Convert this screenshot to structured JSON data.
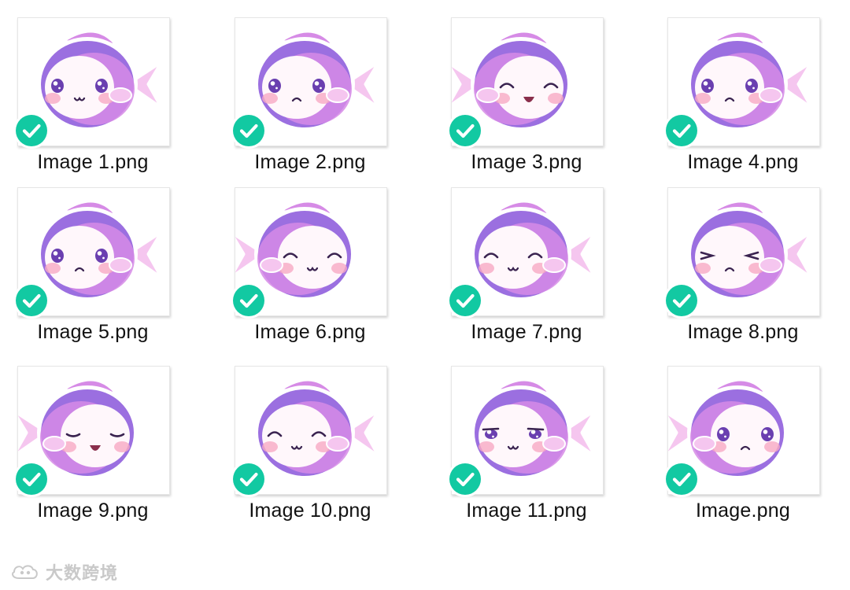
{
  "files": [
    {
      "name": "Image 1.png",
      "selected": true,
      "expression": "sparkle-smile"
    },
    {
      "name": "Image 2.png",
      "selected": true,
      "expression": "sparkle-frown"
    },
    {
      "name": "Image 3.png",
      "selected": true,
      "expression": "laughing"
    },
    {
      "name": "Image 4.png",
      "selected": true,
      "expression": "worried"
    },
    {
      "name": "Image 5.png",
      "selected": true,
      "expression": "sparkle-frown"
    },
    {
      "name": "Image 6.png",
      "selected": true,
      "expression": "closed-smile"
    },
    {
      "name": "Image 7.png",
      "selected": true,
      "expression": "closed-smile"
    },
    {
      "name": "Image 8.png",
      "selected": true,
      "expression": "squint"
    },
    {
      "name": "Image 9.png",
      "selected": true,
      "expression": "wink-talk"
    },
    {
      "name": "Image 10.png",
      "selected": true,
      "expression": "happy"
    },
    {
      "name": "Image 11.png",
      "selected": true,
      "expression": "smirk"
    },
    {
      "name": "Image.png",
      "selected": true,
      "expression": "worried"
    }
  ],
  "colors": {
    "check": "#12c9a2",
    "fish_body_light": "#f5c6ef",
    "fish_body_mid": "#d68be6",
    "fish_body_dark": "#9b6fe0",
    "fish_face": "#fff7fb",
    "blush": "#f7a9c4",
    "eye": "#6a3fb0",
    "label_text": "#111111"
  },
  "icons": {
    "check": "checkmark-icon",
    "watermark": "watermark-logo"
  },
  "watermark": {
    "text": "大数跨境"
  }
}
